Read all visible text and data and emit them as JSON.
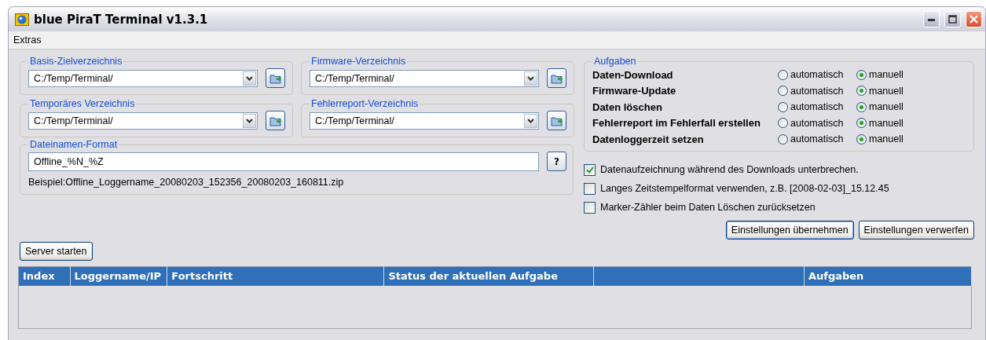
{
  "window": {
    "title": "blue PiraT Terminal v1.3.1"
  },
  "menu": [
    "Extras"
  ],
  "directories": [
    {
      "label": "Basis-Zielverzeichnis",
      "value": "C:/Temp/Terminal/"
    },
    {
      "label": "Firmware-Verzeichnis",
      "value": "C:/Temp/Terminal/"
    },
    {
      "label": "Temporäres Verzeichnis",
      "value": "C:/Temp/Terminal/"
    },
    {
      "label": "Fehlerreport-Verzeichnis",
      "value": "C:/Temp/Terminal/"
    }
  ],
  "filename_format": {
    "label": "Dateinamen-Format",
    "value": "Offline_%N_%Z",
    "help_button": "?",
    "example": "Beispiel:Offline_Loggername_20080203_152356_20080203_160811.zip"
  },
  "tasks": {
    "label": "Aufgaben",
    "rows": [
      {
        "name": "Daten-Download",
        "options": [
          {
            "label": "automatisch",
            "selected": false
          },
          {
            "label": "manuell",
            "selected": true
          }
        ]
      },
      {
        "name": "Firmware-Update",
        "options": [
          {
            "label": "automatisch",
            "selected": false
          },
          {
            "label": "manuell",
            "selected": true
          }
        ]
      },
      {
        "name": "Daten löschen",
        "options": [
          {
            "label": "automatisch",
            "selected": false
          },
          {
            "label": "manuell",
            "selected": true
          }
        ]
      },
      {
        "name": "Fehlerreport im Fehlerfall erstellen",
        "options": [
          {
            "label": "automatisch",
            "selected": false
          },
          {
            "label": "manuell",
            "selected": true
          }
        ]
      },
      {
        "name": "Datenloggerzeit setzen",
        "options": [
          {
            "label": "automatisch",
            "selected": false
          },
          {
            "label": "manuell",
            "selected": true
          }
        ]
      }
    ]
  },
  "options": [
    {
      "label": "Datenaufzeichnung während des Downloads unterbrechen.",
      "checked": true
    },
    {
      "label": "Langes Zeitstempelformat verwenden, z.B. [2008-02-03]_15.12.45",
      "checked": false
    },
    {
      "label": "Marker-Zähler beim Daten Löschen zurücksetzen",
      "checked": false
    }
  ],
  "settings_buttons": [
    "Einstellungen übernehmen",
    "Einstellungen verwerfen"
  ],
  "server_button": "Server starten",
  "table": {
    "columns": [
      "Index",
      "Loggername/IP",
      "Fortschritt",
      "Status der aktuellen Aufgabe",
      null,
      "Aufgaben"
    ]
  }
}
